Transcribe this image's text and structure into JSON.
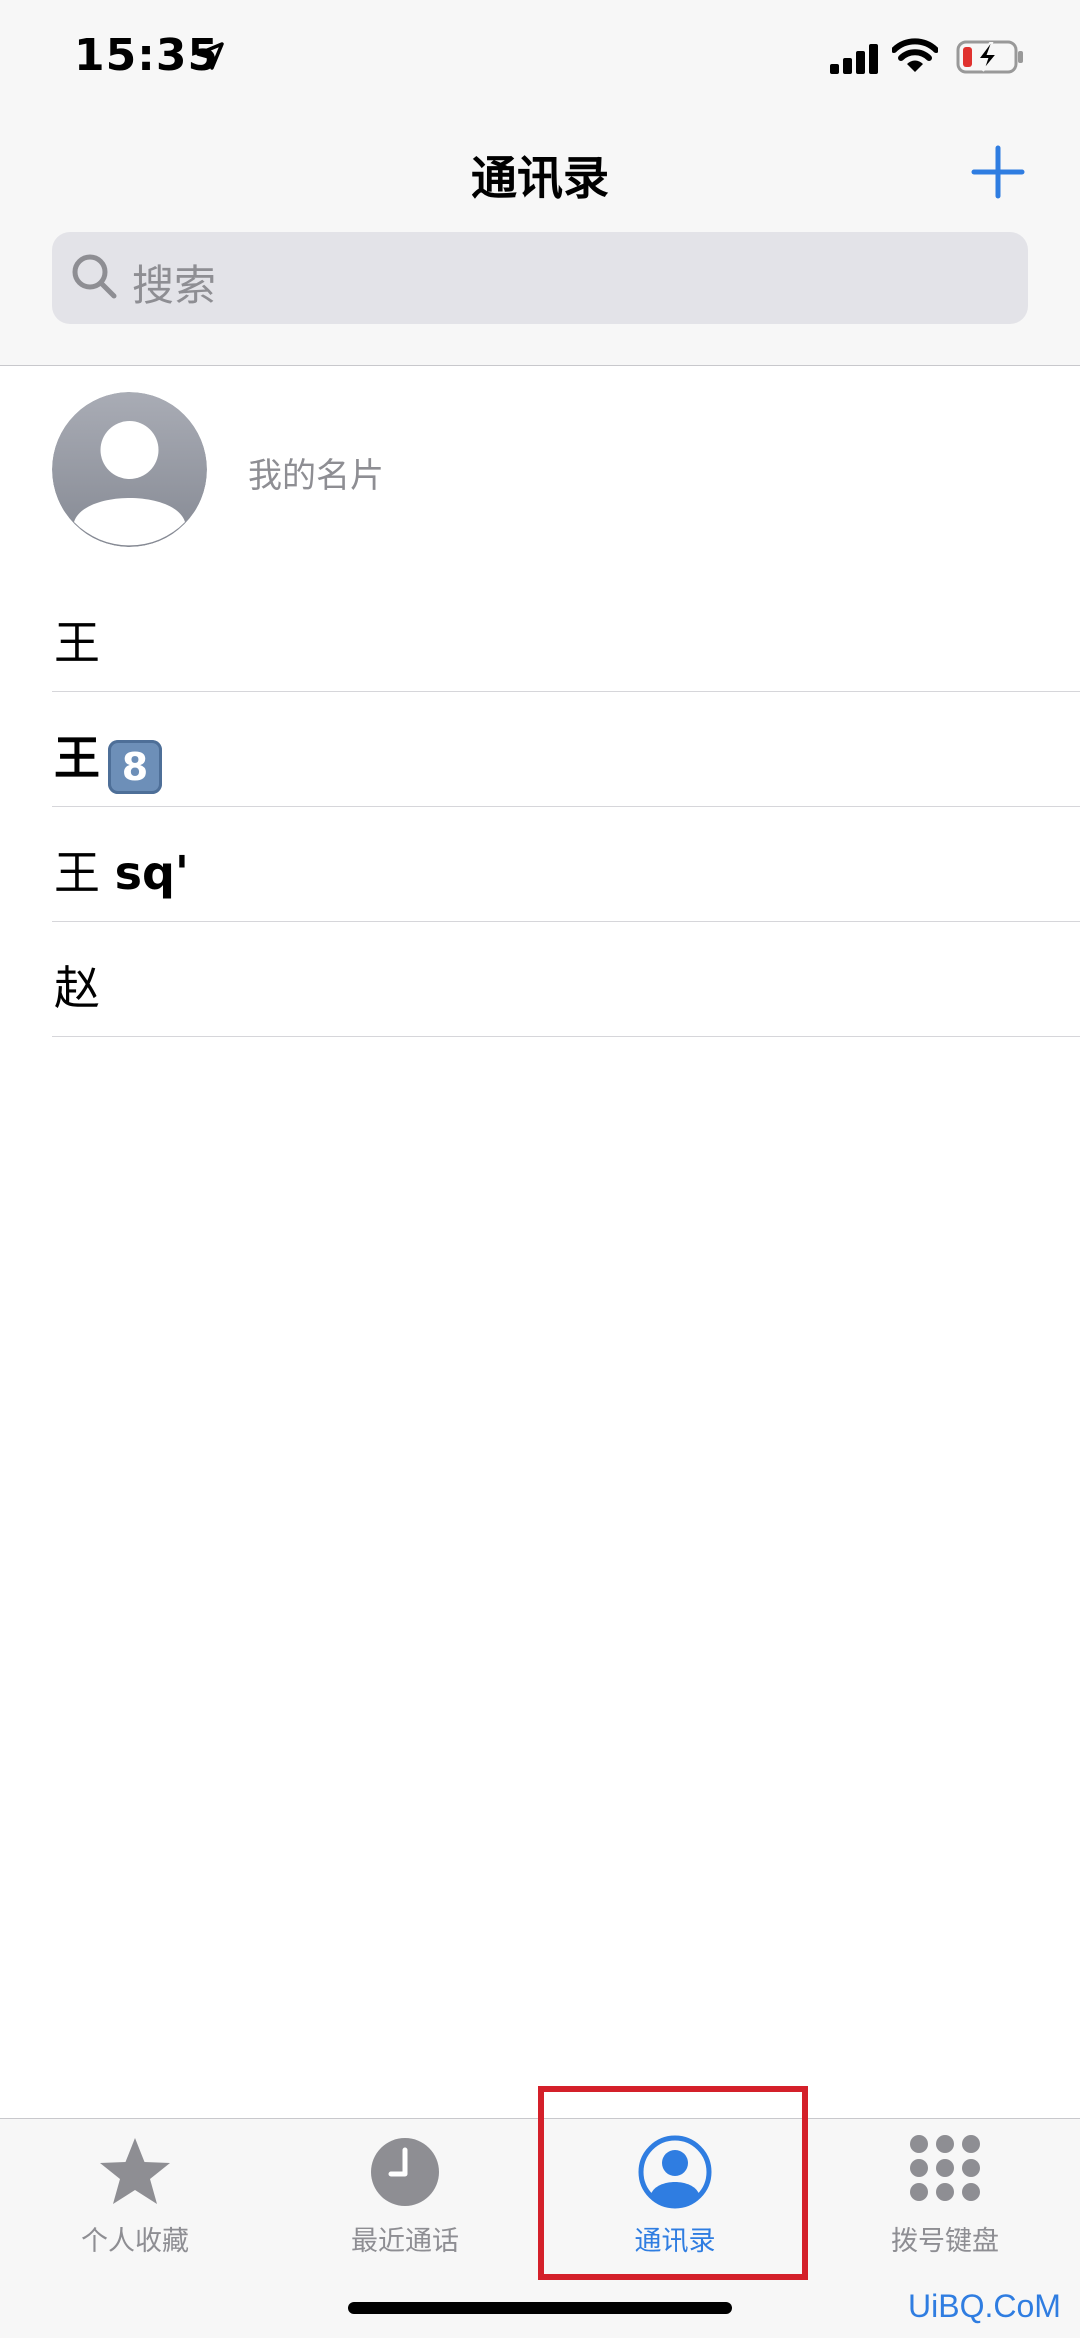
{
  "status": {
    "time": "15:35"
  },
  "nav": {
    "title": "通讯录",
    "add_icon": "plus-icon"
  },
  "search": {
    "placeholder": "搜索"
  },
  "my_card": {
    "label": "我的名片"
  },
  "contacts": [
    {
      "name": "王",
      "badge": ""
    },
    {
      "name": "王",
      "badge": "8"
    },
    {
      "name": "王",
      "suffix": "sq'"
    },
    {
      "name": "赵"
    }
  ],
  "tabs": [
    {
      "label": "个人收藏",
      "icon": "star-icon",
      "active": false
    },
    {
      "label": "最近通话",
      "icon": "clock-icon",
      "active": false
    },
    {
      "label": "通讯录",
      "icon": "contacts-icon",
      "active": true
    },
    {
      "label": "拨号键盘",
      "icon": "keypad-icon",
      "active": false
    }
  ],
  "colors": {
    "accent": "#2f7de1",
    "highlight": "#d4202a",
    "gray": "#8e8e93"
  },
  "watermark": "UiBQ.CoM"
}
